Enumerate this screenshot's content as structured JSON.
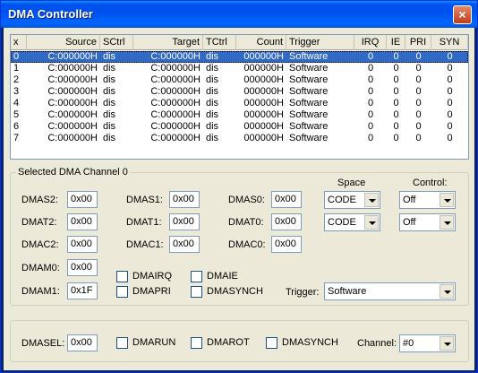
{
  "window": {
    "title": "DMA Controller",
    "close_glyph": "×"
  },
  "list": {
    "columns": [
      "x",
      "Source",
      "SCtrl",
      "Target",
      "TCtrl",
      "Count",
      "Trigger",
      "IRQ",
      "IE",
      "PRI",
      "SYN"
    ],
    "rows": [
      [
        "0",
        "C:000000H",
        "dis",
        "C:000000H",
        "dis",
        "000000H",
        "Software",
        "0",
        "0",
        "0",
        "0"
      ],
      [
        "1",
        "C:000000H",
        "dis",
        "C:000000H",
        "dis",
        "000000H",
        "Software",
        "0",
        "0",
        "0",
        "0"
      ],
      [
        "2",
        "C:000000H",
        "dis",
        "C:000000H",
        "dis",
        "000000H",
        "Software",
        "0",
        "0",
        "0",
        "0"
      ],
      [
        "3",
        "C:000000H",
        "dis",
        "C:000000H",
        "dis",
        "000000H",
        "Software",
        "0",
        "0",
        "0",
        "0"
      ],
      [
        "4",
        "C:000000H",
        "dis",
        "C:000000H",
        "dis",
        "000000H",
        "Software",
        "0",
        "0",
        "0",
        "0"
      ],
      [
        "5",
        "C:000000H",
        "dis",
        "C:000000H",
        "dis",
        "000000H",
        "Software",
        "0",
        "0",
        "0",
        "0"
      ],
      [
        "6",
        "C:000000H",
        "dis",
        "C:000000H",
        "dis",
        "000000H",
        "Software",
        "0",
        "0",
        "0",
        "0"
      ],
      [
        "7",
        "C:000000H",
        "dis",
        "C:000000H",
        "dis",
        "000000H",
        "Software",
        "0",
        "0",
        "0",
        "0"
      ]
    ]
  },
  "channel": {
    "group_label": "Selected DMA Channel 0",
    "space_label": "Space",
    "control_label": "Control:",
    "fields": {
      "dmas2": {
        "label": "DMAS2:",
        "value": "0x00"
      },
      "dmas1": {
        "label": "DMAS1:",
        "value": "0x00"
      },
      "dmas0": {
        "label": "DMAS0:",
        "value": "0x00"
      },
      "dmat2": {
        "label": "DMAT2:",
        "value": "0x00"
      },
      "dmat1": {
        "label": "DMAT1:",
        "value": "0x00"
      },
      "dmat0": {
        "label": "DMAT0:",
        "value": "0x00"
      },
      "dmac2": {
        "label": "DMAC2:",
        "value": "0x00"
      },
      "dmac1": {
        "label": "DMAC1:",
        "value": "0x00"
      },
      "dmac0": {
        "label": "DMAC0:",
        "value": "0x00"
      },
      "dmam0": {
        "label": "DMAM0:",
        "value": "0x00"
      },
      "dmam1": {
        "label": "DMAM1:",
        "value": "0x1F"
      }
    },
    "space_source": "CODE",
    "space_target": "CODE",
    "control_source": "Off",
    "control_target": "Off",
    "checks": {
      "dmairq": "DMAIRQ",
      "dmaie": "DMAIE",
      "dmapri": "DMAPRI",
      "dmasynch": "DMASYNCH"
    },
    "trigger_label": "Trigger:",
    "trigger_value": "Software"
  },
  "bottom": {
    "dmasel_label": "DMASEL:",
    "dmasel_value": "0x00",
    "dmarun": "DMARUN",
    "dmarot": "DMAROT",
    "dmasynch": "DMASYNCH",
    "channel_label": "Channel:",
    "channel_value": "#0"
  }
}
